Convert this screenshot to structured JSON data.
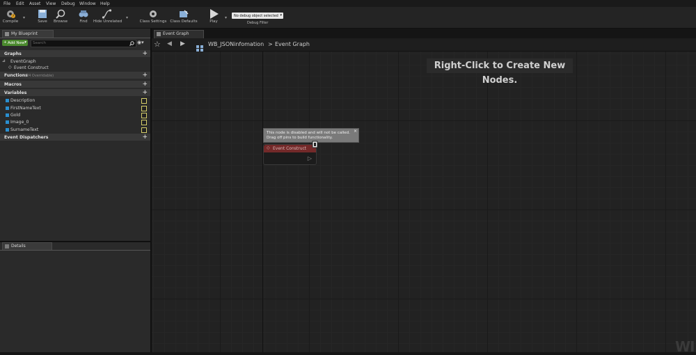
{
  "menu": [
    "File",
    "Edit",
    "Asset",
    "View",
    "Debug",
    "Window",
    "Help"
  ],
  "toolbar": {
    "compile": "Compile",
    "save": "Save",
    "browse": "Browse",
    "find": "Find",
    "hide_unrelated": "Hide Unrelated",
    "class_settings": "Class Settings",
    "class_defaults": "Class Defaults",
    "play": "Play",
    "debug_object": "No debug object selected",
    "debug_filter": "Debug Filter"
  },
  "left_panel": {
    "tab_title": "My Blueprint",
    "add_new": "Add New",
    "search_placeholder": "Search",
    "graphs_header": "Graphs",
    "graph_name": "EventGraph",
    "graph_child": "Event Construct",
    "functions_header": "Functions",
    "functions_note": "(24 Overridable)",
    "macros_header": "Macros",
    "variables_header": "Variables",
    "variables": [
      "Description",
      "FirstNameText",
      "Gold",
      "Image_0",
      "SurnameText"
    ],
    "dispatchers_header": "Event Dispatchers",
    "details_tab": "Details"
  },
  "graph": {
    "tab_title": "Event Graph",
    "breadcrumb_root": "WB_JSONinfomation",
    "breadcrumb_sep": ">",
    "breadcrumb_current": "Event Graph",
    "hint": "Right-Click to Create New Nodes.",
    "tooltip_line1": "This node is disabled and will not be called.",
    "tooltip_line2": "Drag off pins to build functionality.",
    "node_title": "Event Construct",
    "watermark": "WI"
  },
  "colors": {
    "node_header": "#7a2a2a",
    "variable_pin": "#2a8fd0",
    "add_new": "#4b8a2e"
  }
}
